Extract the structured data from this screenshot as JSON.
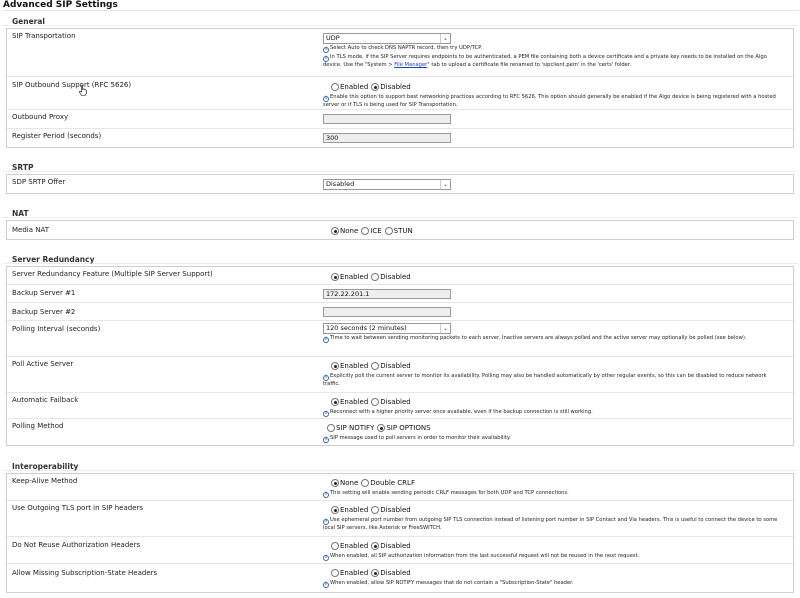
{
  "title": "Advanced SIP Settings",
  "general": {
    "title": "General",
    "sip_transport": {
      "label": "SIP Transportation",
      "value": "UDP",
      "help1": "Select Auto to check DNS NAPTR record, then try UDP/TCP.",
      "help2a": "In TLS mode, if the SIP Server requires endpoints to be authenticated, a PEM file containing both a device certificate and a private key needs to be installed on the Algo device. Use the \"System > ",
      "help2_link": "File Manager",
      "help2b": "\" tab to upload a certificate file renamed to 'sipclient.pem' in the 'certs' folder."
    },
    "outbound_support": {
      "label": "SIP Outbound Support (RFC 5626)",
      "opt_enabled": "Enabled",
      "opt_disabled": "Disabled",
      "help": "Enable this option to support best networking practices according to RFC 5626. This option should generally be enabled if the Algo device is being registered with a hosted server or if TLS is being used for SIP Transportation."
    },
    "outbound_proxy": {
      "label": "Outbound Proxy",
      "value": ""
    },
    "register_period": {
      "label": "Register Period (seconds)",
      "value": "300"
    }
  },
  "srtp": {
    "title": "SRTP",
    "sdp_offer": {
      "label": "SDP SRTP Offer",
      "value": "Disabled"
    }
  },
  "nat": {
    "title": "NAT",
    "media_nat": {
      "label": "Media NAT",
      "opt_none": "None",
      "opt_ice": "ICE",
      "opt_stun": "STUN"
    }
  },
  "redundancy": {
    "title": "Server Redundancy",
    "feature": {
      "label": "Server Redundancy Feature (Multiple SIP Server Support)",
      "opt_enabled": "Enabled",
      "opt_disabled": "Disabled"
    },
    "backup1": {
      "label": "Backup Server #1",
      "value": "172.22.201.1"
    },
    "backup2": {
      "label": "Backup Server #2",
      "value": ""
    },
    "polling_interval": {
      "label": "Polling Interval (seconds)",
      "value": "120 seconds (2 minutes)",
      "help": "Time to wait between sending monitoring packets to each server. Inactive servers are always polled and the active server may optionally be polled (see below)."
    },
    "poll_active": {
      "label": "Poll Active Server",
      "opt_enabled": "Enabled",
      "opt_disabled": "Disabled",
      "help": "Explicitly poll the current server to monitor its availability. Polling may also be handled automatically by other regular events, so this can be disabled to reduce network traffic."
    },
    "auto_failback": {
      "label": "Automatic Failback",
      "opt_enabled": "Enabled",
      "opt_disabled": "Disabled",
      "help": "Reconnect with a higher priority server once available, even if the backup connection is still working."
    },
    "polling_method": {
      "label": "Polling Method",
      "opt_notify": "SIP NOTIFY",
      "opt_options": "SIP OPTIONS",
      "help": "SIP message used to poll servers in order to monitor their availability."
    }
  },
  "interop": {
    "title": "Interoperability",
    "keepalive": {
      "label": "Keep-Alive Method",
      "opt_none": "None",
      "opt_crlf": "Double CRLF",
      "help": "This setting will enable sending periodic CRLF messages for both UDP and TCP connections."
    },
    "outgoing_tls": {
      "label": "Use Outgoing TLS port in SIP headers",
      "opt_enabled": "Enabled",
      "opt_disabled": "Disabled",
      "help": "Use ephemeral port number from outgoing SIP TLS connection instead of listening port number in SIP Contact and Via headers. This is useful to connect the device to some local SIP servers, like Asterisk or FreeSWITCH."
    },
    "no_reuse_auth": {
      "label": "Do Not Reuse Authorization Headers",
      "opt_enabled": "Enabled",
      "opt_disabled": "Disabled",
      "help": "When enabled, all SIP authorization information from the last successful request will not be reused in the next request."
    },
    "missing_sub_state": {
      "label": "Allow Missing Subscription-State Headers",
      "opt_enabled": "Enabled",
      "opt_disabled": "Disabled",
      "help": "When enabled, allow SIP NOTIFY messages that do not contain a \"Subscription-State\" header."
    }
  }
}
